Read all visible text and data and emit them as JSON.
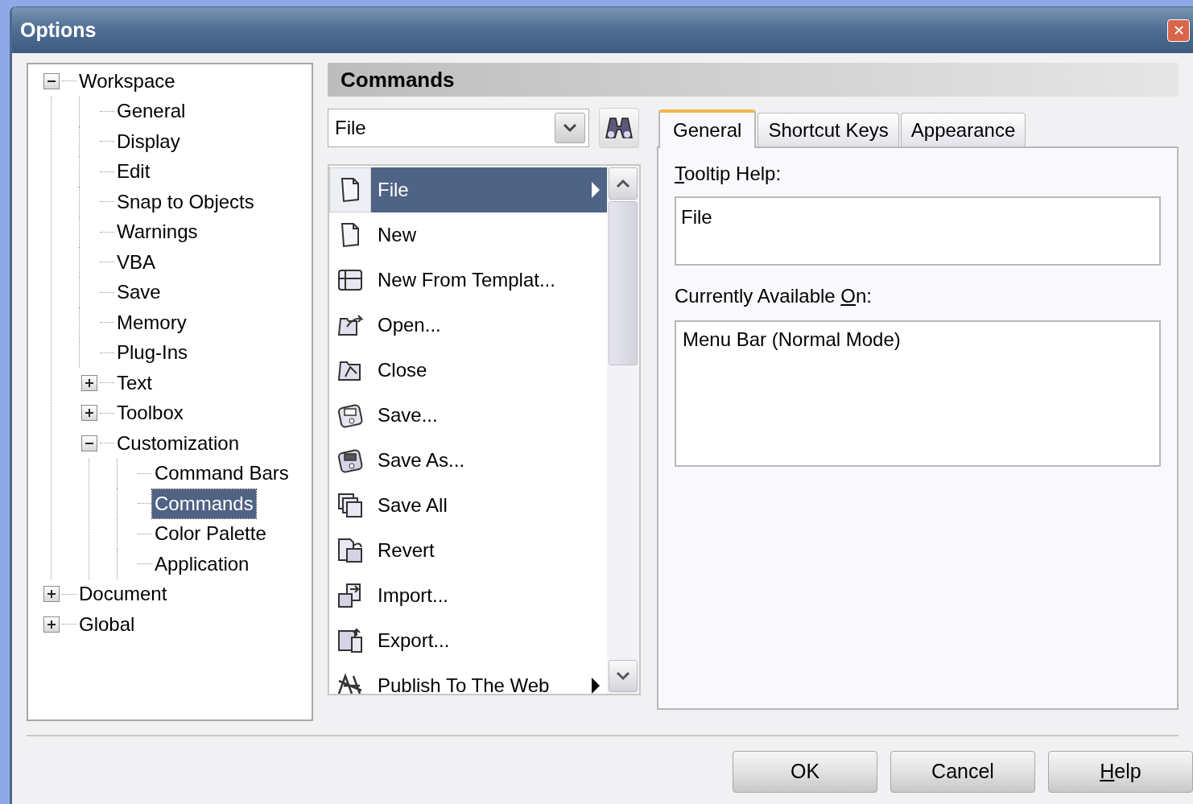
{
  "window": {
    "title": "Options",
    "close": "✕"
  },
  "tree": [
    {
      "label": "Workspace",
      "expanded": true,
      "selected": false,
      "children": [
        {
          "label": "General",
          "selected": false
        },
        {
          "label": "Display",
          "selected": false
        },
        {
          "label": "Edit",
          "selected": false
        },
        {
          "label": "Snap to Objects",
          "selected": false
        },
        {
          "label": "Warnings",
          "selected": false
        },
        {
          "label": "VBA",
          "selected": false
        },
        {
          "label": "Save",
          "selected": false
        },
        {
          "label": "Memory",
          "selected": false
        },
        {
          "label": "Plug-Ins",
          "selected": false
        },
        {
          "label": "Text",
          "expanded": false,
          "selected": false
        },
        {
          "label": "Toolbox",
          "expanded": false,
          "selected": false
        },
        {
          "label": "Customization",
          "expanded": true,
          "selected": false,
          "children": [
            {
              "label": "Command Bars",
              "selected": false
            },
            {
              "label": "Commands",
              "selected": true
            },
            {
              "label": "Color Palette",
              "selected": false
            },
            {
              "label": "Application",
              "selected": false
            }
          ]
        }
      ]
    },
    {
      "label": "Document",
      "expanded": false,
      "selected": false
    },
    {
      "label": "Global",
      "expanded": false,
      "selected": false
    }
  ],
  "panel": {
    "title": "Commands",
    "dropdown": {
      "value": "File"
    },
    "commands": [
      {
        "label": "File",
        "selected": true,
        "submenu": true
      },
      {
        "label": "New",
        "selected": false,
        "submenu": false
      },
      {
        "label": "New From Templat...",
        "selected": false,
        "submenu": false
      },
      {
        "label": "Open...",
        "selected": false,
        "submenu": false
      },
      {
        "label": "Close",
        "selected": false,
        "submenu": false
      },
      {
        "label": "Save...",
        "selected": false,
        "submenu": false
      },
      {
        "label": "Save As...",
        "selected": false,
        "submenu": false
      },
      {
        "label": "Save All",
        "selected": false,
        "submenu": false
      },
      {
        "label": "Revert",
        "selected": false,
        "submenu": false
      },
      {
        "label": "Import...",
        "selected": false,
        "submenu": false
      },
      {
        "label": "Export...",
        "selected": false,
        "submenu": false
      },
      {
        "label": "Publish To The Web",
        "selected": false,
        "submenu": true
      }
    ],
    "tabs": [
      {
        "label": "General",
        "selected": true
      },
      {
        "label": "Shortcut Keys",
        "selected": false
      },
      {
        "label": "Appearance",
        "selected": false
      }
    ],
    "tooltip_help": {
      "label": {
        "underlined": "T",
        "after": "ooltip Help:"
      },
      "value": "File"
    },
    "available_on": {
      "label": {
        "before": "Currently Available ",
        "underlined": "O",
        "after": "n:"
      },
      "items": [
        "Menu Bar (Normal Mode)"
      ]
    }
  },
  "buttons": [
    {
      "label": {
        "before": "OK"
      }
    },
    {
      "label": {
        "before": "Cancel"
      }
    },
    {
      "label": {
        "underlined": "H",
        "after": "elp"
      }
    }
  ]
}
